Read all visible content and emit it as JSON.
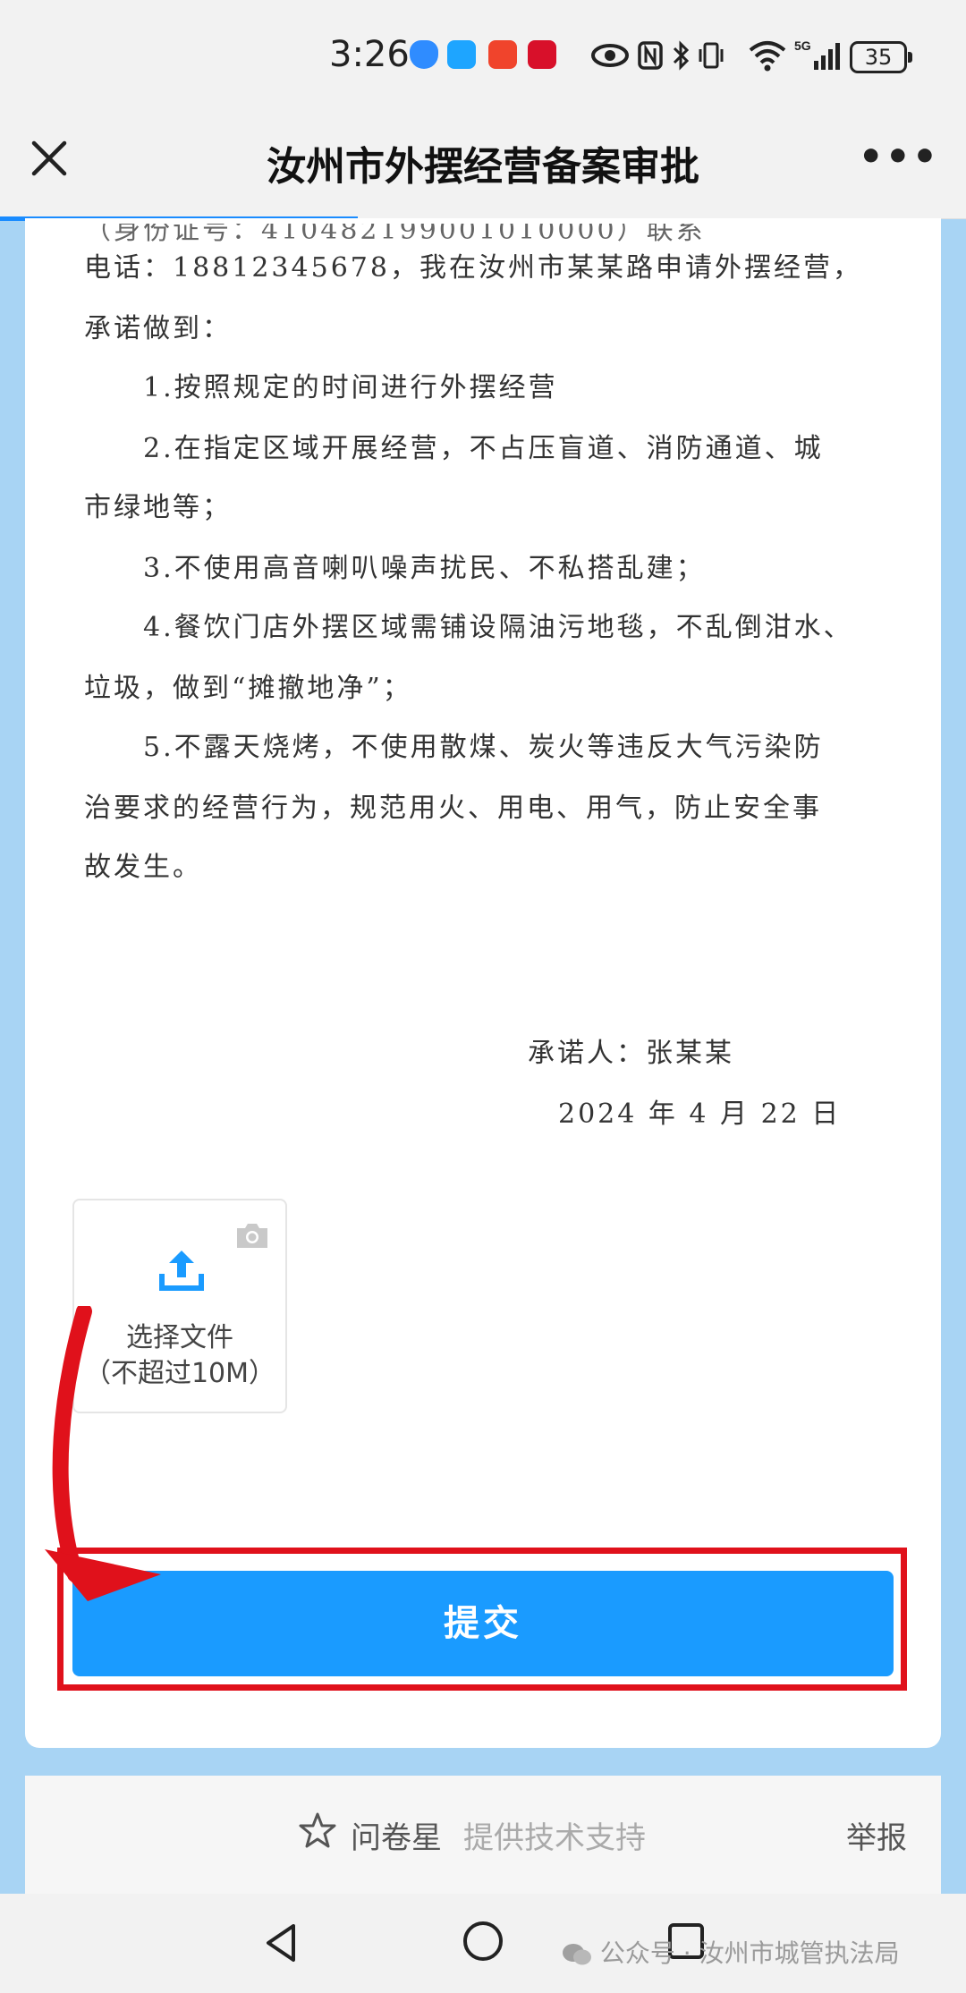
{
  "status_bar": {
    "time": "3:26",
    "battery": "35",
    "network": "5G"
  },
  "nav": {
    "title": "汝州市外摆经营备案审批"
  },
  "document": {
    "lines": [
      "电话：18812345678，我在汝州市某某路申请外摆经营，",
      "承诺做到：",
      "1.按照规定的时间进行外摆经营",
      "2.在指定区域开展经营，不占压盲道、消防通道、城",
      "市绿地等；",
      "3.不使用高音喇叭噪声扰民、不私搭乱建；",
      "4.餐饮门店外摆区域需铺设隔油污地毯，不乱倒泔水、",
      "垃圾，做到“摊撤地净”；",
      "5.不露天烧烤，不使用散煤、炭火等违反大气污染防",
      "治要求的经营行为，规范用火、用电、用气，防止安全事",
      "故发生。"
    ],
    "signer": "承诺人：张某某",
    "date": "2024 年 4 月 22 日"
  },
  "upload": {
    "label": "选择文件",
    "hint": "（不超过10M）"
  },
  "submit": {
    "label": "提交"
  },
  "footer": {
    "brand": "问卷星",
    "support": "提供技术支持",
    "report": "举报"
  },
  "watermark": "公众号 · 汝州市城管执法局",
  "colors": {
    "primary": "#1a9bff",
    "highlight_frame": "#e0111b",
    "page_bg": "#a8d4f4"
  }
}
